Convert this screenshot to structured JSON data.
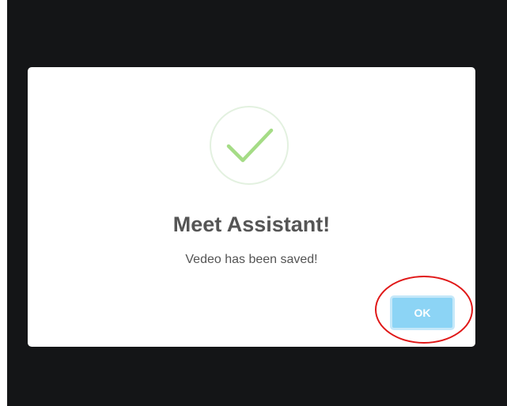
{
  "dialog": {
    "icon": "checkmark-success-icon",
    "title": "Meet Assistant!",
    "message": "Vedeo has been saved!",
    "ok_label": "OK"
  },
  "colors": {
    "backdrop": "#141517",
    "checkmark": "#a5dc86",
    "ok_button": "#8cd4f5",
    "annotation": "#e01818"
  }
}
